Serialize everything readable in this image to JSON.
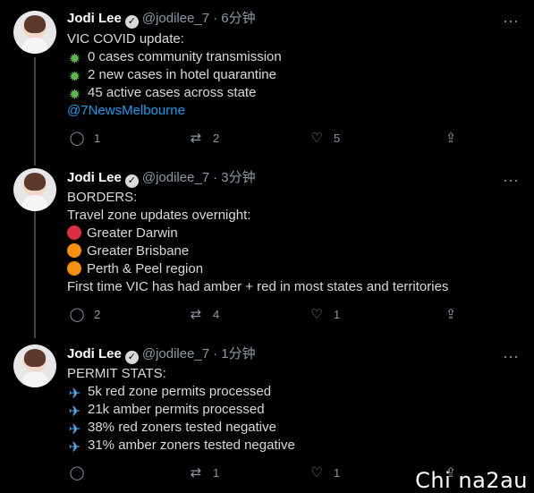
{
  "tweets": [
    {
      "name": "Jodi Lee",
      "handle": "@jodilee_7",
      "time": "· 6分钟",
      "lines": [
        {
          "icon": "virus",
          "text": "VIC COVID update:"
        },
        {
          "icon": "virus",
          "text": "0 cases community transmission"
        },
        {
          "icon": "virus",
          "text": "2 new cases in hotel quarantine"
        },
        {
          "icon": "virus",
          "text": "45 active cases across state"
        },
        {
          "icon": "",
          "text": "@7NewsMelbourne"
        }
      ],
      "reply": "1",
      "retweet": "2",
      "like": "5"
    },
    {
      "name": "Jodi Lee",
      "handle": "@jodilee_7",
      "time": "· 3分钟",
      "lines": [
        {
          "icon": "",
          "text": "BORDERS:"
        },
        {
          "icon": "",
          "text": "Travel zone updates overnight:"
        },
        {
          "icon": "red-circle",
          "text": "Greater Darwin"
        },
        {
          "icon": "amber-circle",
          "text": "Greater Brisbane"
        },
        {
          "icon": "amber-circle",
          "text": "Perth & Peel region"
        },
        {
          "icon": "",
          "text": "First time VIC has had amber + red in most states and territories"
        }
      ],
      "reply": "2",
      "retweet": "4",
      "like": "1"
    },
    {
      "name": "Jodi Lee",
      "handle": "@jodilee_7",
      "time": "· 1分钟",
      "lines": [
        {
          "icon": "",
          "text": "PERMIT STATS:"
        },
        {
          "icon": "plane",
          "text": "5k red zone permits processed"
        },
        {
          "icon": "plane",
          "text": "21k amber permits processed"
        },
        {
          "icon": "plane",
          "text": "38% red zoners tested negative"
        },
        {
          "icon": "plane",
          "text": "31% amber zoners tested negative"
        }
      ],
      "reply": "",
      "retweet": "1",
      "like": "1"
    }
  ],
  "icons": {
    "verified": "✓",
    "more": "···",
    "reply": "◯",
    "retweet": "⇄",
    "like": "♡",
    "share": "⇪",
    "virus": "✹",
    "plane": "✈"
  },
  "watermark": "Chi na2au",
  "colors": {
    "background": "#000000",
    "link": "#1d9bf0",
    "muted": "#8b98a5"
  }
}
